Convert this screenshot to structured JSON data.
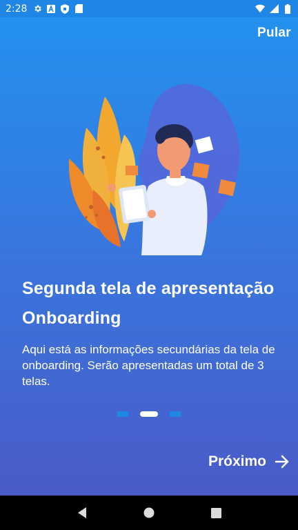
{
  "status_bar": {
    "time": "2:28",
    "left_icons": [
      "gear-icon",
      "font-icon",
      "shield-icon",
      "sd-card-icon"
    ],
    "right_icons": [
      "wifi-icon",
      "signal-icon",
      "battery-icon"
    ]
  },
  "header": {
    "skip_label": "Pular"
  },
  "content": {
    "title": "Segunda tela de apresentação Onboarding",
    "description": "Aqui está as informações secundárias da tela de onboarding. Serão apresentadas um total de 3 telas."
  },
  "pager": {
    "total": 3,
    "current": 2
  },
  "footer": {
    "next_label": "Próximo"
  },
  "colors": {
    "accent": "#1e88e5",
    "background_top": "#2391ee",
    "background_bottom": "#4a5bc8"
  },
  "nav_bar": {
    "buttons": [
      "back-icon",
      "home-icon",
      "recents-icon"
    ]
  }
}
